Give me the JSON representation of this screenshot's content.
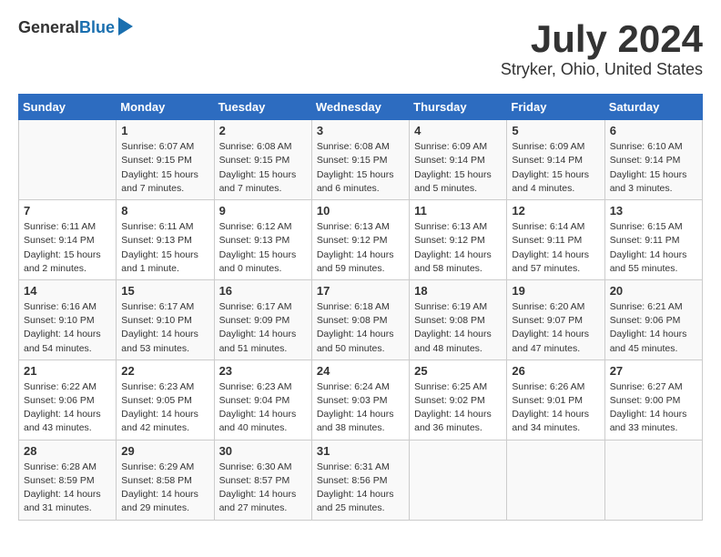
{
  "logo": {
    "general": "General",
    "blue": "Blue"
  },
  "title": {
    "month_year": "July 2024",
    "location": "Stryker, Ohio, United States"
  },
  "headers": [
    "Sunday",
    "Monday",
    "Tuesday",
    "Wednesday",
    "Thursday",
    "Friday",
    "Saturday"
  ],
  "weeks": [
    [
      {
        "day": "",
        "info": ""
      },
      {
        "day": "1",
        "info": "Sunrise: 6:07 AM\nSunset: 9:15 PM\nDaylight: 15 hours\nand 7 minutes."
      },
      {
        "day": "2",
        "info": "Sunrise: 6:08 AM\nSunset: 9:15 PM\nDaylight: 15 hours\nand 7 minutes."
      },
      {
        "day": "3",
        "info": "Sunrise: 6:08 AM\nSunset: 9:15 PM\nDaylight: 15 hours\nand 6 minutes."
      },
      {
        "day": "4",
        "info": "Sunrise: 6:09 AM\nSunset: 9:14 PM\nDaylight: 15 hours\nand 5 minutes."
      },
      {
        "day": "5",
        "info": "Sunrise: 6:09 AM\nSunset: 9:14 PM\nDaylight: 15 hours\nand 4 minutes."
      },
      {
        "day": "6",
        "info": "Sunrise: 6:10 AM\nSunset: 9:14 PM\nDaylight: 15 hours\nand 3 minutes."
      }
    ],
    [
      {
        "day": "7",
        "info": "Sunrise: 6:11 AM\nSunset: 9:14 PM\nDaylight: 15 hours\nand 2 minutes."
      },
      {
        "day": "8",
        "info": "Sunrise: 6:11 AM\nSunset: 9:13 PM\nDaylight: 15 hours\nand 1 minute."
      },
      {
        "day": "9",
        "info": "Sunrise: 6:12 AM\nSunset: 9:13 PM\nDaylight: 15 hours\nand 0 minutes."
      },
      {
        "day": "10",
        "info": "Sunrise: 6:13 AM\nSunset: 9:12 PM\nDaylight: 14 hours\nand 59 minutes."
      },
      {
        "day": "11",
        "info": "Sunrise: 6:13 AM\nSunset: 9:12 PM\nDaylight: 14 hours\nand 58 minutes."
      },
      {
        "day": "12",
        "info": "Sunrise: 6:14 AM\nSunset: 9:11 PM\nDaylight: 14 hours\nand 57 minutes."
      },
      {
        "day": "13",
        "info": "Sunrise: 6:15 AM\nSunset: 9:11 PM\nDaylight: 14 hours\nand 55 minutes."
      }
    ],
    [
      {
        "day": "14",
        "info": "Sunrise: 6:16 AM\nSunset: 9:10 PM\nDaylight: 14 hours\nand 54 minutes."
      },
      {
        "day": "15",
        "info": "Sunrise: 6:17 AM\nSunset: 9:10 PM\nDaylight: 14 hours\nand 53 minutes."
      },
      {
        "day": "16",
        "info": "Sunrise: 6:17 AM\nSunset: 9:09 PM\nDaylight: 14 hours\nand 51 minutes."
      },
      {
        "day": "17",
        "info": "Sunrise: 6:18 AM\nSunset: 9:08 PM\nDaylight: 14 hours\nand 50 minutes."
      },
      {
        "day": "18",
        "info": "Sunrise: 6:19 AM\nSunset: 9:08 PM\nDaylight: 14 hours\nand 48 minutes."
      },
      {
        "day": "19",
        "info": "Sunrise: 6:20 AM\nSunset: 9:07 PM\nDaylight: 14 hours\nand 47 minutes."
      },
      {
        "day": "20",
        "info": "Sunrise: 6:21 AM\nSunset: 9:06 PM\nDaylight: 14 hours\nand 45 minutes."
      }
    ],
    [
      {
        "day": "21",
        "info": "Sunrise: 6:22 AM\nSunset: 9:06 PM\nDaylight: 14 hours\nand 43 minutes."
      },
      {
        "day": "22",
        "info": "Sunrise: 6:23 AM\nSunset: 9:05 PM\nDaylight: 14 hours\nand 42 minutes."
      },
      {
        "day": "23",
        "info": "Sunrise: 6:23 AM\nSunset: 9:04 PM\nDaylight: 14 hours\nand 40 minutes."
      },
      {
        "day": "24",
        "info": "Sunrise: 6:24 AM\nSunset: 9:03 PM\nDaylight: 14 hours\nand 38 minutes."
      },
      {
        "day": "25",
        "info": "Sunrise: 6:25 AM\nSunset: 9:02 PM\nDaylight: 14 hours\nand 36 minutes."
      },
      {
        "day": "26",
        "info": "Sunrise: 6:26 AM\nSunset: 9:01 PM\nDaylight: 14 hours\nand 34 minutes."
      },
      {
        "day": "27",
        "info": "Sunrise: 6:27 AM\nSunset: 9:00 PM\nDaylight: 14 hours\nand 33 minutes."
      }
    ],
    [
      {
        "day": "28",
        "info": "Sunrise: 6:28 AM\nSunset: 8:59 PM\nDaylight: 14 hours\nand 31 minutes."
      },
      {
        "day": "29",
        "info": "Sunrise: 6:29 AM\nSunset: 8:58 PM\nDaylight: 14 hours\nand 29 minutes."
      },
      {
        "day": "30",
        "info": "Sunrise: 6:30 AM\nSunset: 8:57 PM\nDaylight: 14 hours\nand 27 minutes."
      },
      {
        "day": "31",
        "info": "Sunrise: 6:31 AM\nSunset: 8:56 PM\nDaylight: 14 hours\nand 25 minutes."
      },
      {
        "day": "",
        "info": ""
      },
      {
        "day": "",
        "info": ""
      },
      {
        "day": "",
        "info": ""
      }
    ]
  ]
}
